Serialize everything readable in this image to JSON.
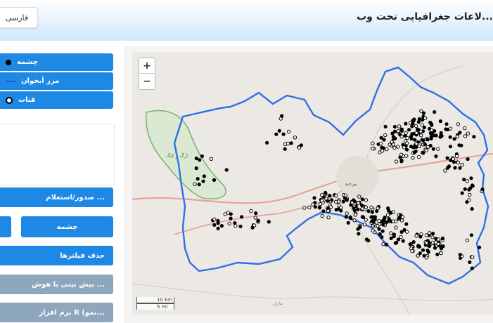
{
  "header": {
    "title": "...لاعات جغرافیایی تحت وب",
    "language_button": "فارسی"
  },
  "sidebar": {
    "legend": [
      {
        "label": "چشمه",
        "icon": "filled-circle-icon"
      },
      {
        "label": "مرز آبخوان",
        "icon": "line-icon"
      },
      {
        "label": "قنات",
        "icon": "hollow-circle-icon"
      }
    ],
    "export_button": "صدور/استعلام ...",
    "spring_button": "چشمه",
    "clear_filters_button": "حذف فیلترها",
    "ai_prediction_button": "پیش بینی با هوش ...",
    "r_software_button": "نرم افزار R (نمو..."
  },
  "map": {
    "zoom_in": "+",
    "zoom_out": "−",
    "scale_km": "10 km",
    "scale_mi": "5 mi",
    "city_label": "بیرجند",
    "place_label": "ارگ و کنگ",
    "road_label": "مازان"
  },
  "colors": {
    "accent": "#1e88e5",
    "disabled": "#8fa7bd",
    "boundary": "#1f4fd8"
  }
}
